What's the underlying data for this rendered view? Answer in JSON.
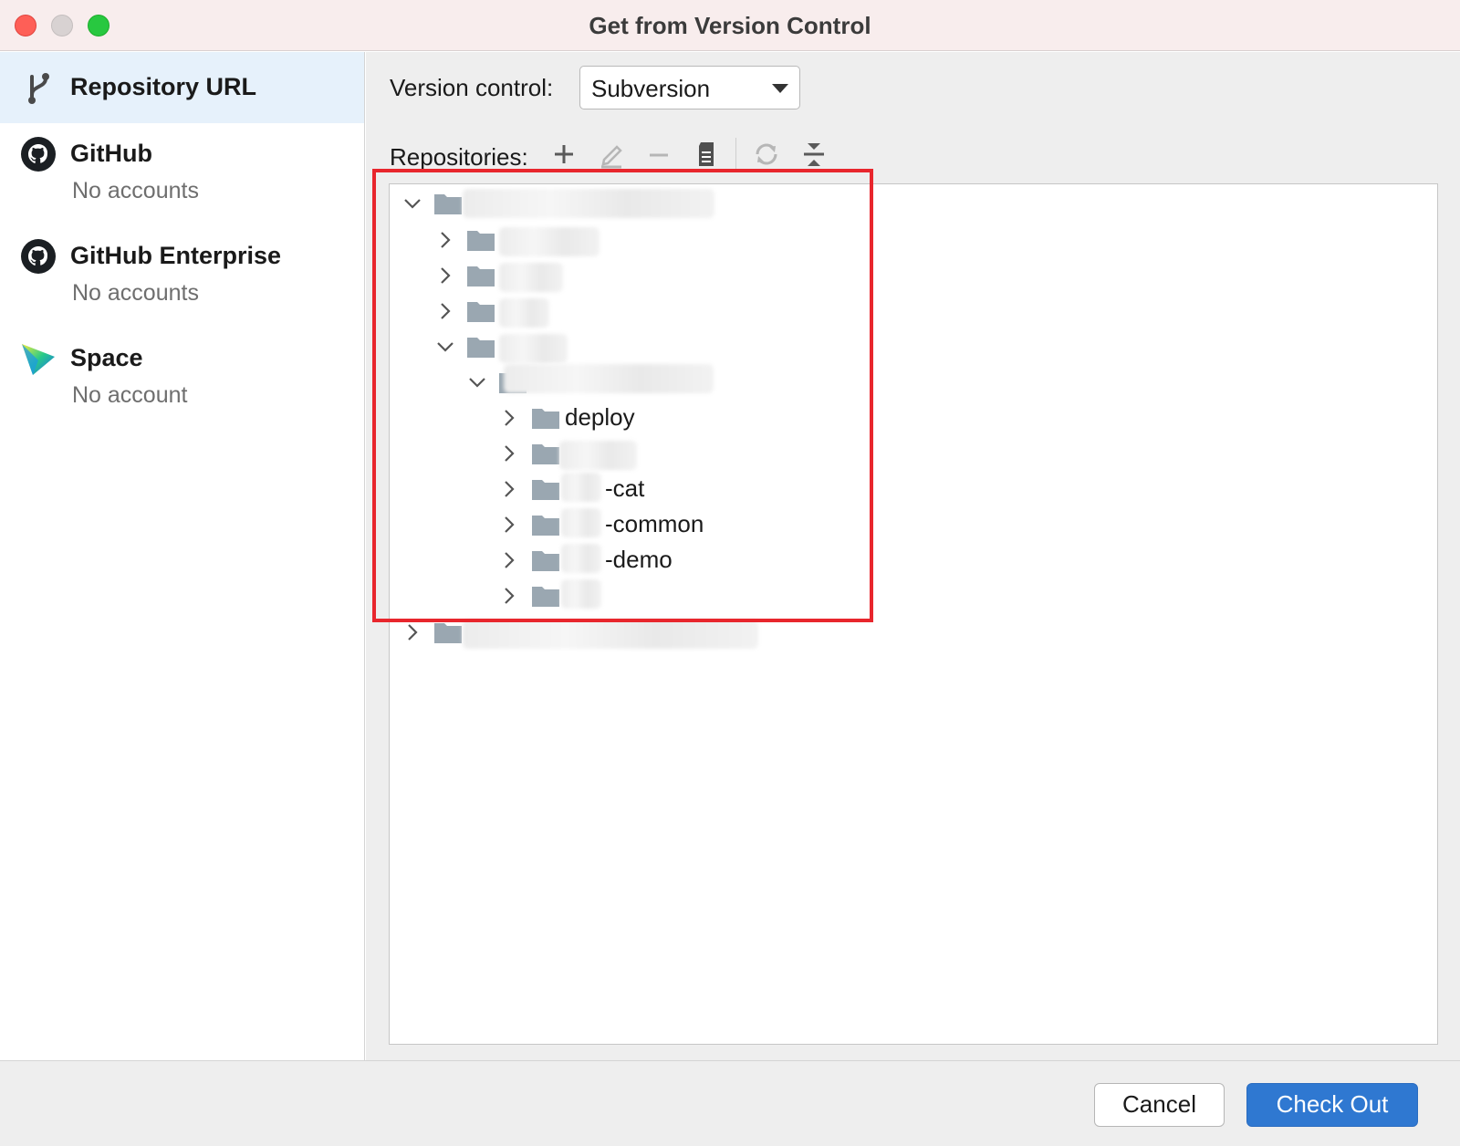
{
  "window": {
    "title": "Get from Version Control"
  },
  "sidebar": {
    "items": [
      {
        "title": "Repository URL",
        "subtitle": "",
        "icon": "branch-icon",
        "selected": true
      },
      {
        "title": "GitHub",
        "subtitle": "No accounts",
        "icon": "github-icon",
        "selected": false
      },
      {
        "title": "GitHub Enterprise",
        "subtitle": "No accounts",
        "icon": "github-icon",
        "selected": false
      },
      {
        "title": "Space",
        "subtitle": "No account",
        "icon": "space-icon",
        "selected": false
      }
    ]
  },
  "main": {
    "version_control_label": "Version control:",
    "version_control_value": "Subversion",
    "repositories_label": "Repositories:",
    "toolbar_icons": [
      "add-icon",
      "edit-icon",
      "remove-icon",
      "browse-icon",
      "refresh-icon",
      "collapse-all-icon"
    ],
    "tree": {
      "rows": [
        {
          "label": "",
          "expanded": true
        },
        {
          "label": "",
          "expanded": false
        },
        {
          "label": "",
          "expanded": false
        },
        {
          "label": "",
          "expanded": false
        },
        {
          "label": "",
          "expanded": true
        },
        {
          "label": "",
          "expanded": true
        },
        {
          "label": "deploy",
          "expanded": false
        },
        {
          "label": "",
          "expanded": false
        },
        {
          "label": "-cat",
          "expanded": false
        },
        {
          "label": "-common",
          "expanded": false
        },
        {
          "label": "-demo",
          "expanded": false
        },
        {
          "label": "",
          "expanded": false
        },
        {
          "label": "",
          "expanded": false
        }
      ]
    }
  },
  "footer": {
    "cancel_label": "Cancel",
    "primary_label": "Check Out"
  },
  "colors": {
    "primary": "#2f78d1",
    "selection": "#e6f1fb",
    "highlight": "#e8262d",
    "folder": "#9aa7b1"
  }
}
